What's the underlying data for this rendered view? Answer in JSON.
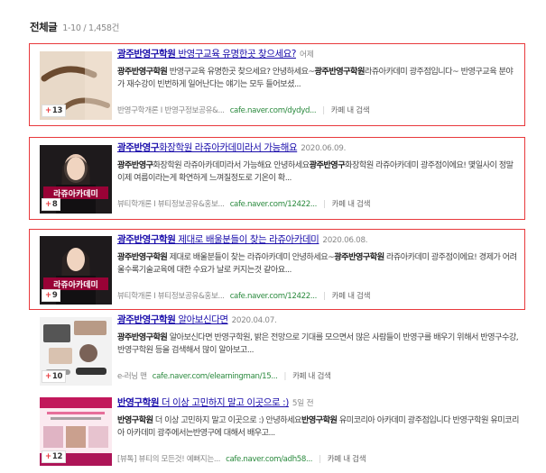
{
  "header": {
    "title": "전체글",
    "count": "1-10 / 1,458건"
  },
  "results": [
    {
      "badge": "13",
      "title_bold": "광주반영구학원",
      "title_rest": " 반영구교육 유명한곳 찾으세요?",
      "date": "어제",
      "desc_bold1": "광주반영구학원",
      "desc_mid": " 반영구교육 유명한곳 찾으세요? 안녕하세요~",
      "desc_bold2": "광주반영구학원",
      "desc_rest": "라쥬아카데미 광주점입니다~ 반영구교육 분야가 재수강이 빈번하게 일어난다는 얘기는 모두 들어보셨...",
      "category": "반영구학개론 I 반영구정보공유&...",
      "url": "cafe.naver.com/dydyd...",
      "link": "카페 내 검색"
    },
    {
      "badge": "8",
      "title_bold": "광주반영구",
      "title_rest": "화장학원 라쥬아카데미라서 가능해요",
      "date": "2020.06.09.",
      "desc_bold1": "광주반영구",
      "desc_mid": "화장학원 라쥬아카데미라서 가능해요 안녕하세요",
      "desc_bold2": "광주반영구",
      "desc_rest": "화장학원 라쥬아카데미 광주점이에요! 몇일사이 정말 이제 여름이라는게 확연하게 느껴질정도로 기온이 확...",
      "category": "뷰티학개론 I 뷰티정보공유&홍보...",
      "url": "cafe.naver.com/12422...",
      "link": "카페 내 검색"
    },
    {
      "badge": "9",
      "title_bold": "광주반영구학원",
      "title_rest": " 제대로 배울분들이 찾는 라쥬아카데미",
      "date": "2020.06.08.",
      "desc_bold1": "광주반영구학원",
      "desc_mid": " 제대로 배울분들이 찾는 라쥬아카데미 안녕하세요~",
      "desc_bold2": "광주반영구학원",
      "desc_rest": " 라쥬아카데미 광주점이에요! 경제가 어려울수록기술교육에 대한 수요가 날로 커지는것 같아요...",
      "category": "뷰티학개론 I 뷰티정보공유&홍보...",
      "url": "cafe.naver.com/12422...",
      "link": "카페 내 검색"
    },
    {
      "badge": "10",
      "title_bold": "광주반영구학원",
      "title_rest": " 알아보신다면",
      "date": "2020.04.07.",
      "desc_bold1": "광주반영구학원",
      "desc_mid": " 알아보신다면 반영구학원, 밝은 전망으로 기대를 모으면서 많은 사람들이 반영구를 배우기 위해서 반영구수강, 반영구학원 등을 검색해서 많이 알아보고...",
      "desc_bold2": "",
      "desc_rest": "",
      "category": "e-러닝 맨",
      "url": "cafe.naver.com/elearningman/15...",
      "link": "카페 내 검색"
    },
    {
      "badge": "12",
      "title_bold": "반영구학원",
      "title_rest": " 더 이상 고민하지 말고 이곳으로 :)",
      "date": "5일 전",
      "desc_bold1": "반영구학원",
      "desc_mid": " 더 이상 고민하지 말고 이곳으로 :) 안녕하세요",
      "desc_bold2": "반영구학원",
      "desc_rest": " 유미코리아 아카데미 광주점입니다 반영구학원 유미코리아 아카데미 광주에서는반영구에 대해서 배우고...",
      "category": "[뷰톡] 뷰티의 모든것! 예뻐지는...",
      "url": "cafe.naver.com/adh58...",
      "link": "카페 내 검색"
    }
  ]
}
